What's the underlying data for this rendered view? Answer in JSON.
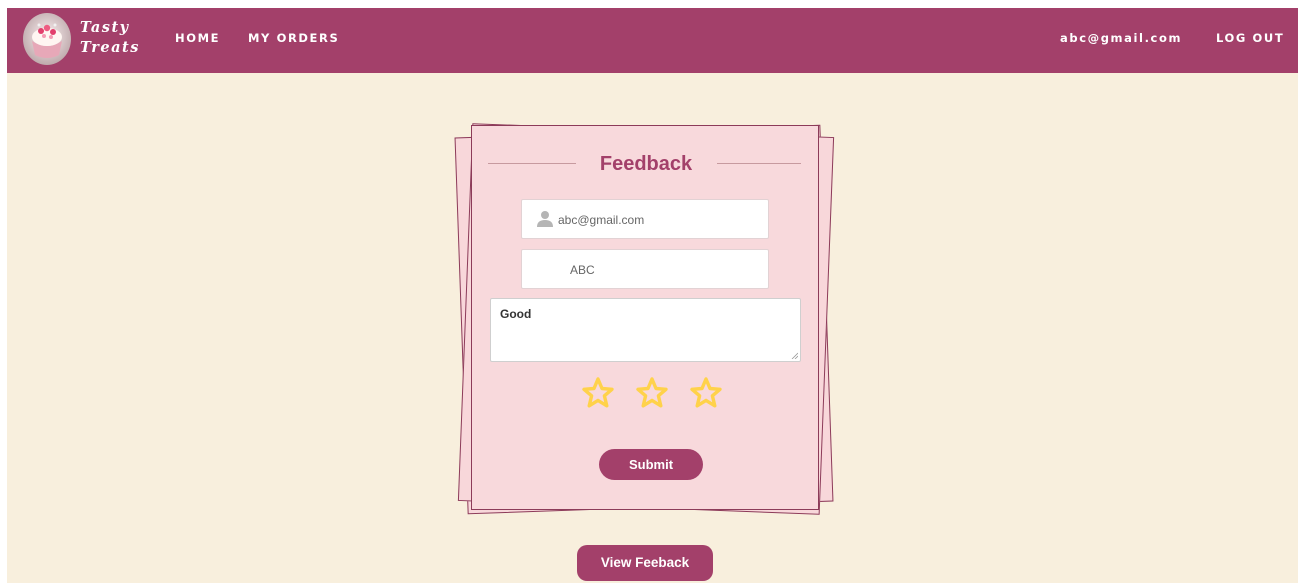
{
  "navbar": {
    "brand_line1": "Tasty",
    "brand_line2": "Treats",
    "links": [
      {
        "label": "HOME"
      },
      {
        "label": "MY ORDERS"
      }
    ],
    "user_email": "abc@gmail.com",
    "logout_label": "LOG OUT",
    "logo_icon": "cupcake-logo-icon"
  },
  "feedback_form": {
    "title": "Feedback",
    "email_value": "abc@gmail.com",
    "email_icon": "user-icon",
    "name_value": "ABC",
    "comment_value": "Good",
    "rating_star_count": 3,
    "submit_label": "Submit"
  },
  "view_feedback_label": "View Feeback",
  "colors": {
    "brand": "#a3406a",
    "page_background": "#f8efdd",
    "card_background": "#f8d9dc",
    "star": "#ffd24a"
  }
}
